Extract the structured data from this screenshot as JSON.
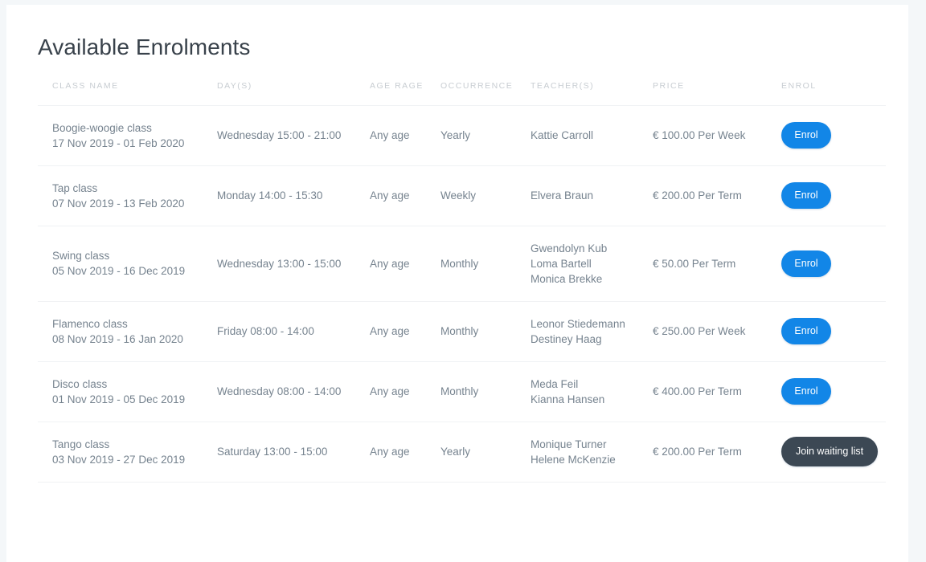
{
  "page": {
    "title": "Available Enrolments",
    "card_background": "#ffffff",
    "app_background": "#f4f7f9",
    "accent_color": "#1286e7",
    "waitlist_color": "#3c4854"
  },
  "table": {
    "headers": {
      "class_name": "CLASS NAME",
      "days": "DAY(S)",
      "age_range": "AGE RAGE",
      "occurrence": "OCCURRENCE",
      "teachers": "TEACHER(S)",
      "price": "PRICE",
      "enrol": "ENROL"
    },
    "rows": [
      {
        "class_name": "Boogie-woogie class",
        "date_range": "17 Nov 2019 - 01 Feb 2020",
        "days": "Wednesday 15:00 - 21:00",
        "age_range": "Any age",
        "occurrence": "Yearly",
        "teachers": [
          "Kattie Carroll"
        ],
        "price": "€ 100.00 Per Week",
        "action": {
          "label": "Enrol",
          "type": "enrol"
        }
      },
      {
        "class_name": "Tap class",
        "date_range": "07 Nov 2019 - 13 Feb 2020",
        "days": "Monday 14:00 - 15:30",
        "age_range": "Any age",
        "occurrence": "Weekly",
        "teachers": [
          "Elvera Braun"
        ],
        "price": "€ 200.00 Per Term",
        "action": {
          "label": "Enrol",
          "type": "enrol"
        }
      },
      {
        "class_name": "Swing class",
        "date_range": "05 Nov 2019 - 16 Dec 2019",
        "days": "Wednesday 13:00 - 15:00",
        "age_range": "Any age",
        "occurrence": "Monthly",
        "teachers": [
          "Gwendolyn Kub",
          "Loma Bartell",
          "Monica Brekke"
        ],
        "price": "€ 50.00 Per Term",
        "action": {
          "label": "Enrol",
          "type": "enrol"
        }
      },
      {
        "class_name": "Flamenco class",
        "date_range": "08 Nov 2019 - 16 Jan 2020",
        "days": "Friday 08:00 - 14:00",
        "age_range": "Any age",
        "occurrence": "Monthly",
        "teachers": [
          "Leonor Stiedemann",
          "Destiney Haag"
        ],
        "price": "€ 250.00 Per Week",
        "action": {
          "label": "Enrol",
          "type": "enrol"
        }
      },
      {
        "class_name": "Disco class",
        "date_range": "01 Nov 2019 - 05 Dec 2019",
        "days": "Wednesday 08:00 - 14:00",
        "age_range": "Any age",
        "occurrence": "Monthly",
        "teachers": [
          "Meda Feil",
          "Kianna Hansen"
        ],
        "price": "€ 400.00 Per Term",
        "action": {
          "label": "Enrol",
          "type": "enrol"
        }
      },
      {
        "class_name": "Tango class",
        "date_range": "03 Nov 2019 - 27 Dec 2019",
        "days": "Saturday 13:00 - 15:00",
        "age_range": "Any age",
        "occurrence": "Yearly",
        "teachers": [
          "Monique Turner",
          "Helene McKenzie"
        ],
        "price": "€ 200.00 Per Term",
        "action": {
          "label": "Join waiting list",
          "type": "waiting"
        }
      }
    ]
  }
}
